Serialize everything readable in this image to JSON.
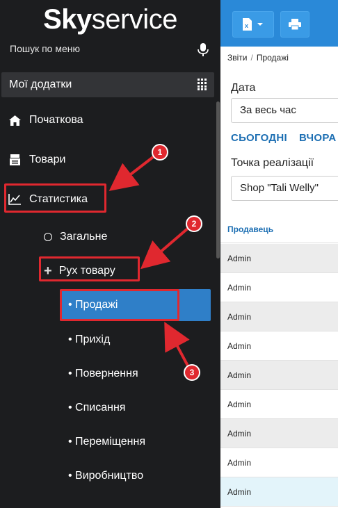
{
  "sidebar": {
    "logo_bold": "Sky",
    "logo_light": "service",
    "search_placeholder": "Пошук по меню",
    "apps_label": "Мої додатки",
    "items": [
      {
        "label": "Початкова",
        "icon": "home-icon"
      },
      {
        "label": "Товари",
        "icon": "box-icon"
      },
      {
        "label": "Статистика",
        "icon": "chart-icon"
      }
    ],
    "stats_sub": [
      {
        "label": "Загальне",
        "icon": "circle-icon"
      },
      {
        "label": "Рух товару",
        "icon": "plus-icon"
      }
    ],
    "movement_leaves": [
      "• Продажі",
      "• Прихід",
      "• Повернення",
      "• Списання",
      "• Переміщення",
      "• Виробництво"
    ],
    "active_leaf": "• Продажі"
  },
  "annotations": [
    "1",
    "2",
    "3"
  ],
  "toolbar": {
    "export_icon": "excel-dropdown-icon",
    "print_icon": "print-icon"
  },
  "breadcrumb": {
    "root": "Звіти",
    "sep": "/",
    "current": "Продажі"
  },
  "filters": {
    "date_label": "Дата",
    "date_value": "За весь час",
    "quick_today": "СЬОГОДНІ",
    "quick_yesterday": "ВЧОРА",
    "point_label": "Точка реалізації",
    "point_value": "Shop \"Tali Welly\""
  },
  "table": {
    "column": "Продавець",
    "rows": [
      "Admin",
      "Admin",
      "Admin",
      "Admin",
      "Admin",
      "Admin",
      "Admin",
      "Admin",
      "Admin"
    ]
  },
  "colors": {
    "accent": "#2a89d8",
    "sidebar_bg": "#1c1d1f",
    "annotation_red": "#e0282f",
    "row_alt": "#ececec",
    "row_highlight": "#e3f4fa"
  }
}
